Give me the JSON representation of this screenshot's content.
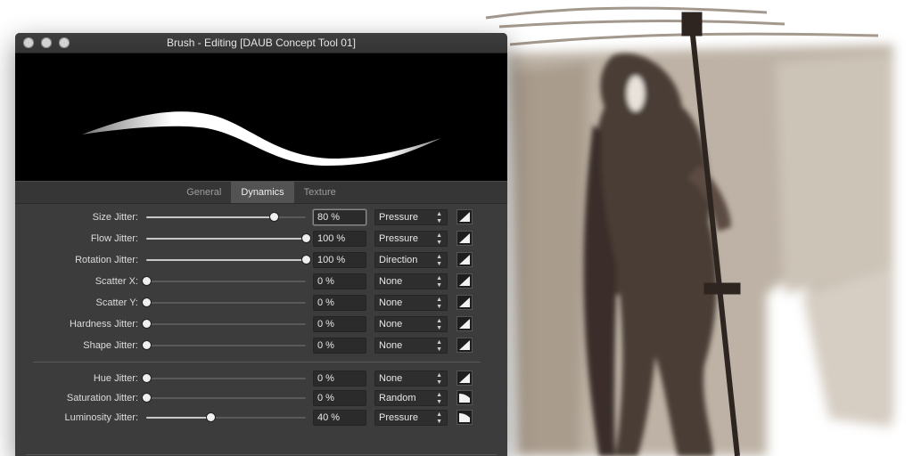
{
  "window": {
    "title": "Brush - Editing [DAUB Concept Tool 01]"
  },
  "tabs": [
    {
      "label": "General",
      "active": false
    },
    {
      "label": "Dynamics",
      "active": true
    },
    {
      "label": "Texture",
      "active": false
    }
  ],
  "dynamics": [
    {
      "name": "size-jitter",
      "label": "Size Jitter:",
      "value": "80 %",
      "fraction": 0.8,
      "controller": "Pressure",
      "curve": "linear",
      "focused": true
    },
    {
      "name": "flow-jitter",
      "label": "Flow Jitter:",
      "value": "100 %",
      "fraction": 1.0,
      "controller": "Pressure",
      "curve": "linear"
    },
    {
      "name": "rotation-jitter",
      "label": "Rotation Jitter:",
      "value": "100 %",
      "fraction": 1.0,
      "controller": "Direction",
      "curve": "linear"
    },
    {
      "name": "scatter-x",
      "label": "Scatter X:",
      "value": "0 %",
      "fraction": 0,
      "controller": "None",
      "curve": "linear"
    },
    {
      "name": "scatter-y",
      "label": "Scatter Y:",
      "value": "0 %",
      "fraction": 0,
      "controller": "None",
      "curve": "linear"
    },
    {
      "name": "hardness-jitter",
      "label": "Hardness Jitter:",
      "value": "0 %",
      "fraction": 0,
      "controller": "None",
      "curve": "linear"
    },
    {
      "name": "shape-jitter",
      "label": "Shape Jitter:",
      "value": "0 %",
      "fraction": 0,
      "controller": "None",
      "curve": "linear"
    }
  ],
  "color_dynamics": [
    {
      "name": "hue-jitter",
      "label": "Hue Jitter:",
      "value": "0 %",
      "fraction": 0,
      "controller": "None",
      "curve": "linear"
    },
    {
      "name": "saturation-jitter",
      "label": "Saturation Jitter:",
      "value": "0 %",
      "fraction": 0,
      "controller": "Random",
      "curve": "rounded"
    },
    {
      "name": "luminosity-jitter",
      "label": "Luminosity Jitter:",
      "value": "40 %",
      "fraction": 0.4,
      "controller": "Pressure",
      "curve": "rounded"
    }
  ],
  "colors": {
    "sepia_dark": "#4a3d35",
    "sepia_light": "#b6aa9c"
  }
}
